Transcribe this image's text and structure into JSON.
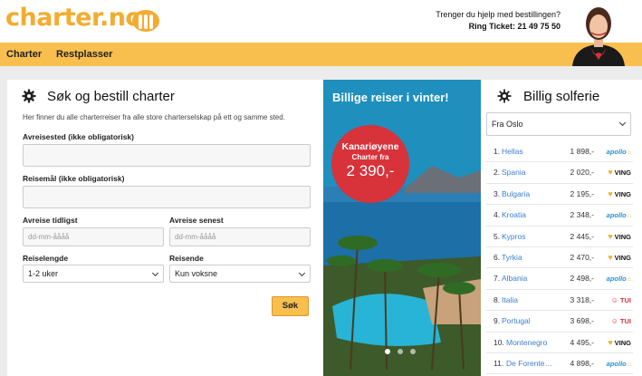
{
  "header": {
    "logo_text": "charter.no",
    "help_line": "Trenger du hjelp med bestillingen?",
    "phone_line": "Ring Ticket: 21 49 75 50"
  },
  "nav": [
    {
      "label": "Charter"
    },
    {
      "label": "Restplasser"
    }
  ],
  "search": {
    "title": "Søk og bestill charter",
    "intro": "Her finner du alle charterreiser fra alle store charterselskap på ett og samme sted.",
    "departure_label": "Avreisested (ikke obligatorisk)",
    "departure_value": "",
    "destination_label": "Reisemål (ikke obligatorisk)",
    "destination_value": "",
    "earliest_label": "Avreise tidligst",
    "earliest_placeholder": "dd-mm-åååå",
    "latest_label": "Avreise senest",
    "latest_placeholder": "dd-mm-åååå",
    "length_label": "Reiselengde",
    "length_value": "1-2 uker",
    "travellers_label": "Reisende",
    "travellers_value": "Kun voksne",
    "submit_label": "Søk"
  },
  "promo": {
    "headline": "Billige reiser i vinter!",
    "destination": "Kanariøyene",
    "subline": "Charter fra",
    "price": "2 390,-",
    "active_slide": 1,
    "slide_count": 3
  },
  "deals": {
    "title": "Billig solferie",
    "origin_value": "Fra Oslo",
    "rows": [
      {
        "num": "1.",
        "dest": "Hellas",
        "price": "1 898,-",
        "operator": "apollo",
        "op_class": "apollo"
      },
      {
        "num": "2.",
        "dest": "Spania",
        "price": "2 020,-",
        "operator": "VING",
        "op_class": "ving"
      },
      {
        "num": "3.",
        "dest": "Bulgaria",
        "price": "2 195,-",
        "operator": "VING",
        "op_class": "ving"
      },
      {
        "num": "4.",
        "dest": "Kroatia",
        "price": "2 348,-",
        "operator": "apollo",
        "op_class": "apollo"
      },
      {
        "num": "5.",
        "dest": "Kypros",
        "price": "2 445,-",
        "operator": "VING",
        "op_class": "ving"
      },
      {
        "num": "6.",
        "dest": "Tyrkia",
        "price": "2 470,-",
        "operator": "VING",
        "op_class": "ving"
      },
      {
        "num": "7.",
        "dest": "Albania",
        "price": "2 498,-",
        "operator": "apollo",
        "op_class": "apollo"
      },
      {
        "num": "8.",
        "dest": "Italia",
        "price": "3 318,-",
        "operator": "TUI",
        "op_class": "tui"
      },
      {
        "num": "9.",
        "dest": "Portugal",
        "price": "3 698,-",
        "operator": "TUI",
        "op_class": "tui"
      },
      {
        "num": "10.",
        "dest": "Montenegro",
        "price": "4 495,-",
        "operator": "VING",
        "op_class": "ving"
      },
      {
        "num": "11.",
        "dest": "De Forente…",
        "price": "4 898,-",
        "operator": "apollo",
        "op_class": "apollo"
      }
    ]
  },
  "colors": {
    "accent": "#f9bf4e",
    "logo": "#f3ac2e",
    "promo_bg": "#1f8fbe",
    "promo_badge": "#d8323a",
    "link": "#3b7fd0"
  }
}
